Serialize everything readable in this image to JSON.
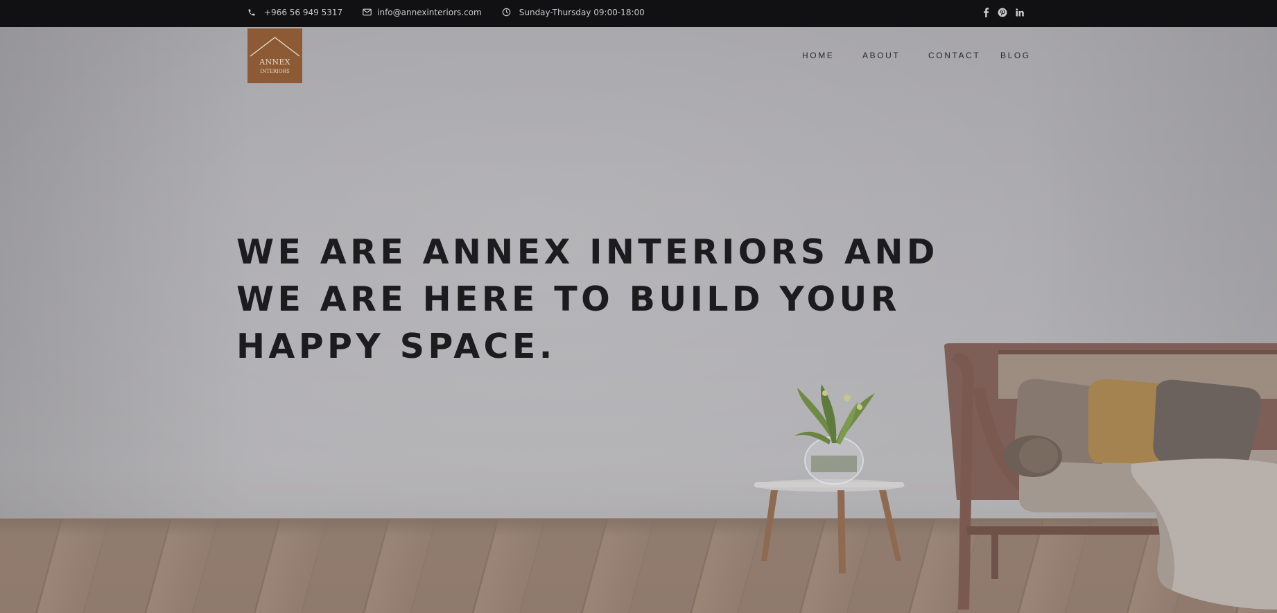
{
  "topbar": {
    "phone": "+966 56 949 5317",
    "email": "info@annexinteriors.com",
    "hours": "Sunday-Thursday 09:00-18:00",
    "icons": [
      "phone-icon",
      "envelope-icon",
      "clock-icon",
      "facebook-icon",
      "pinterest-icon",
      "linkedin-icon"
    ]
  },
  "logo": {
    "line1": "ANNEX",
    "line2": "INTERIORS",
    "color": "#8c5a34"
  },
  "nav": {
    "items": [
      "HOME",
      "ABOUT",
      "CONTACT",
      "BLOG"
    ]
  },
  "hero": {
    "headline": [
      "WE ARE ANNEX INTERIORS AND",
      "WE ARE HERE TO BUILD YOUR",
      "HAPPY SPACE."
    ]
  }
}
